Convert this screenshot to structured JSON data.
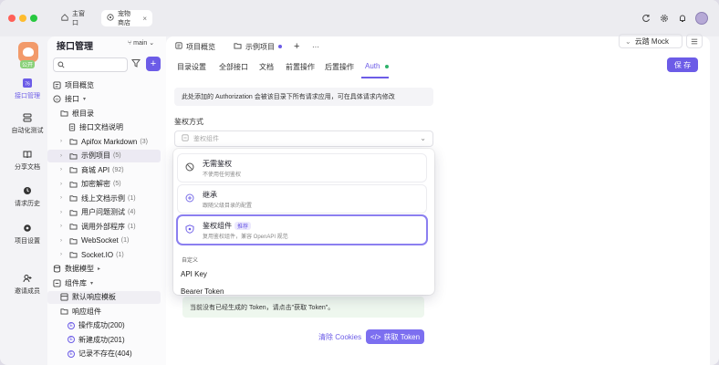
{
  "window": {
    "tabs": [
      {
        "label": "主窗口",
        "icon": "home-icon"
      },
      {
        "label": "宠物商店",
        "icon": "pet-shop-icon"
      }
    ]
  },
  "rail": {
    "public_badge": "公开",
    "items": [
      {
        "label": "接口管理",
        "icon": "api-icon",
        "active": true
      },
      {
        "label": "自动化测试",
        "icon": "test-icon"
      },
      {
        "label": "分享文档",
        "icon": "book-icon"
      },
      {
        "label": "请求历史",
        "icon": "history-icon"
      },
      {
        "label": "项目设置",
        "icon": "settings-icon"
      },
      {
        "label": "邀请成员",
        "icon": "invite-icon"
      }
    ],
    "api_badge_count": "76"
  },
  "tree": {
    "title": "接口管理",
    "branch": "main",
    "rows": [
      {
        "label": "项目概览",
        "indent": 0,
        "icon": "overview-icon"
      },
      {
        "label": "接口",
        "indent": 0,
        "icon": "api-folder-icon",
        "suffix": "▾"
      },
      {
        "label": "根目录",
        "indent": 1,
        "icon": "folder-icon"
      },
      {
        "label": "接口文档说明",
        "indent": 2,
        "icon": "doc-icon"
      },
      {
        "label": "Apifox Markdown",
        "indent": 1,
        "icon": "folder-icon",
        "count": "(3)",
        "chev": true
      },
      {
        "label": "示例项目",
        "indent": 1,
        "icon": "folder-icon",
        "count": "(5)",
        "chev": true,
        "selected": true
      },
      {
        "label": "商城 API",
        "indent": 1,
        "icon": "folder-icon",
        "count": "(92)",
        "chev": true
      },
      {
        "label": "加密解密",
        "indent": 1,
        "icon": "folder-icon",
        "count": "(5)",
        "chev": true
      },
      {
        "label": "线上文档示例",
        "indent": 1,
        "icon": "folder-icon",
        "count": "(1)",
        "chev": true
      },
      {
        "label": "用户问题测试",
        "indent": 1,
        "icon": "folder-icon",
        "count": "(4)",
        "chev": true
      },
      {
        "label": "调用外部程序",
        "indent": 1,
        "icon": "folder-icon",
        "count": "(1)",
        "chev": true
      },
      {
        "label": "WebSocket",
        "indent": 1,
        "icon": "folder-icon",
        "count": "(1)",
        "chev": true
      },
      {
        "label": "Socket.IO",
        "indent": 1,
        "icon": "folder-icon",
        "count": "(1)",
        "chev": true
      },
      {
        "label": "数据模型",
        "indent": 0,
        "icon": "model-icon",
        "suffix": "▸"
      },
      {
        "label": "组件库",
        "indent": 0,
        "icon": "component-icon",
        "suffix": "▾"
      },
      {
        "label": "默认响应模板",
        "indent": 1,
        "icon": "template-icon",
        "selected_light": true
      },
      {
        "label": "响应组件",
        "indent": 1,
        "icon": "folder-icon"
      },
      {
        "label": "操作成功(200)",
        "indent": 2,
        "icon": "e-badge"
      },
      {
        "label": "新建成功(201)",
        "indent": 2,
        "icon": "e-badge"
      },
      {
        "label": "记录不存在(404)",
        "indent": 2,
        "icon": "e-badge"
      }
    ]
  },
  "main": {
    "tabs": [
      {
        "label": "项目概览",
        "icon": "overview-icon"
      },
      {
        "label": "示例项目",
        "icon": "folder-icon",
        "active": true
      }
    ],
    "env": "云踏 Mock",
    "subtabs": [
      "目录设置",
      "全部接口",
      "文档",
      "前置操作",
      "后置操作",
      "Auth"
    ],
    "save_label": "保 存",
    "notice": "此处添加的 Authorization 会被该目录下所有请求应用，可在具体请求内修改",
    "auth_label": "鉴权方式",
    "auth_placeholder": "鉴权组件",
    "token_notice": "当前没有已经生成的 Token，请点击\"获取 Token\"。",
    "clear_cookies": "清除 Cookies",
    "get_token": "获取 Token"
  },
  "dropdown": {
    "options": [
      {
        "title": "无需鉴权",
        "desc": "不使用任何鉴权",
        "icon": "no-auth-icon"
      },
      {
        "title": "继承",
        "desc": "跟随父级目录的配置",
        "icon": "inherit-icon"
      },
      {
        "title": "鉴权组件",
        "badge": "推荐",
        "desc": "复用鉴权组件，兼容 OpenAPI 规范",
        "icon": "shield-icon",
        "selected": true
      }
    ],
    "section": "自定义",
    "items": [
      "API Key",
      "Bearer Token"
    ]
  }
}
